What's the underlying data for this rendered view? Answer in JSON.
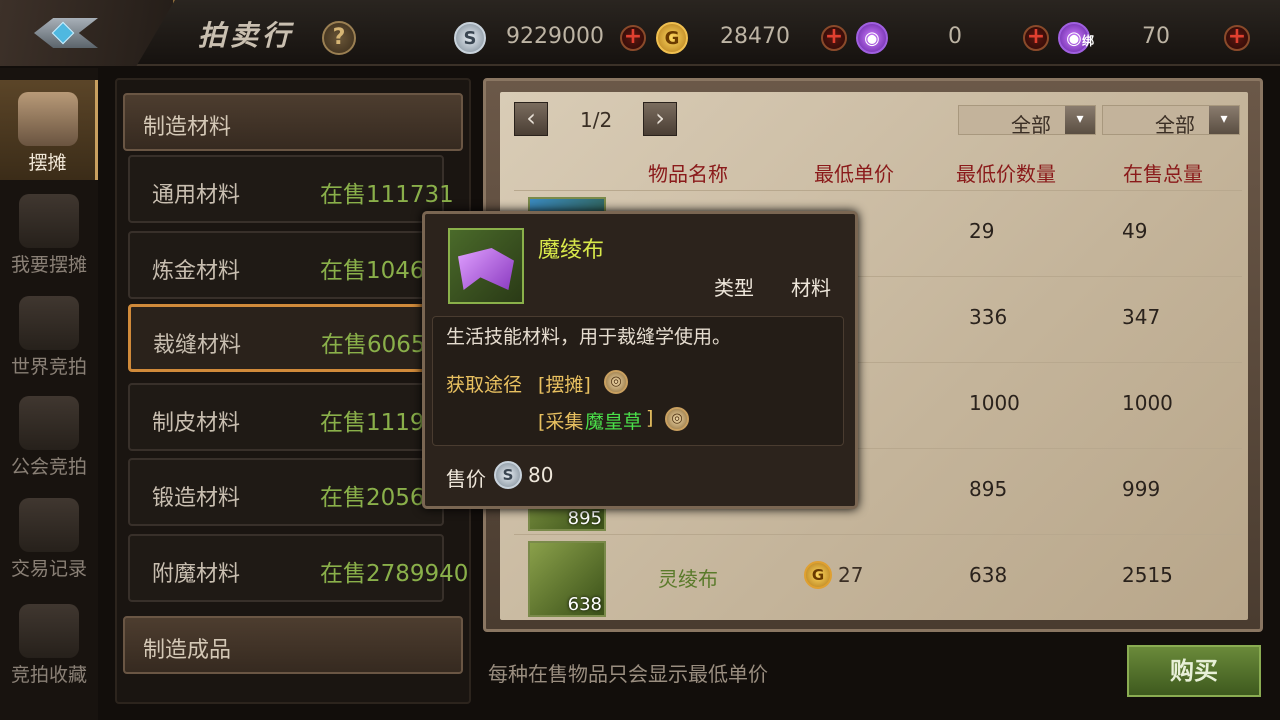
{
  "header": {
    "title": "拍卖行",
    "help_label": "?",
    "currencies": [
      {
        "icon": "silver-coin-icon",
        "value": "9229000"
      },
      {
        "icon": "gold-coin-icon",
        "value": "28470"
      },
      {
        "icon": "purple-crystal-icon",
        "value": "0"
      },
      {
        "icon": "bound-purple-crystal-icon",
        "value": "70",
        "tag": "绑"
      }
    ],
    "plus_label": "+"
  },
  "nav": {
    "items": [
      {
        "label": "摆摊",
        "active": true
      },
      {
        "label": "我要摆摊"
      },
      {
        "label": "世界竞拍"
      },
      {
        "label": "公会竞拍"
      },
      {
        "label": "交易记录"
      },
      {
        "label": "竞拍收藏"
      }
    ]
  },
  "categories": {
    "group1": "制造材料",
    "group2": "制造成品",
    "rows": [
      {
        "name": "通用材料",
        "count": "在售111731"
      },
      {
        "name": "炼金材料",
        "count": "在售1046"
      },
      {
        "name": "裁缝材料",
        "count": "在售6065"
      },
      {
        "name": "制皮材料",
        "count": "在售1119"
      },
      {
        "name": "锻造材料",
        "count": "在售2056"
      },
      {
        "name": "附魔材料",
        "count": "在售2789940"
      }
    ]
  },
  "listing": {
    "prev": "‹",
    "next": "›",
    "page": "1/2",
    "filter1": "全部",
    "filter2": "全部",
    "dropdown_glyph": "▾",
    "columns": [
      "物品名称",
      "最低单价",
      "最低价数量",
      "在售总量"
    ],
    "rows": [
      {
        "name": "",
        "price": "",
        "min_qty": "29",
        "total": "49"
      },
      {
        "name": "",
        "price": "",
        "min_qty": "336",
        "total": "347"
      },
      {
        "name": "",
        "price": "",
        "min_qty": "1000",
        "total": "1000"
      },
      {
        "name": "",
        "price": "",
        "min_qty": "895",
        "total": "999",
        "thumb_count": "895"
      },
      {
        "name": "灵绫布",
        "price": "27",
        "min_qty": "638",
        "total": "2515",
        "thumb_count": "638"
      }
    ],
    "coin_glyph": "G"
  },
  "footer": {
    "hint": "每种在售物品只会显示最低单价",
    "buy_label": "购买"
  },
  "tooltip": {
    "name": "魔绫布",
    "type_label": "类型",
    "type_value": "材料",
    "description": "生活技能材料，用于裁缝学使用。",
    "source_label": "获取途径",
    "source1": "[摆摊]",
    "source2_prefix": "[采集",
    "source2_item": "魔皇草",
    "source2_suffix": "]",
    "price_label": "售价",
    "price_value": "80",
    "silver_glyph": "S"
  },
  "colors": {
    "accent_orange": "#d08a3a",
    "count_green": "#8ab04a",
    "header_red": "#8a1a1a",
    "tooltip_name": "#d8e84a"
  }
}
